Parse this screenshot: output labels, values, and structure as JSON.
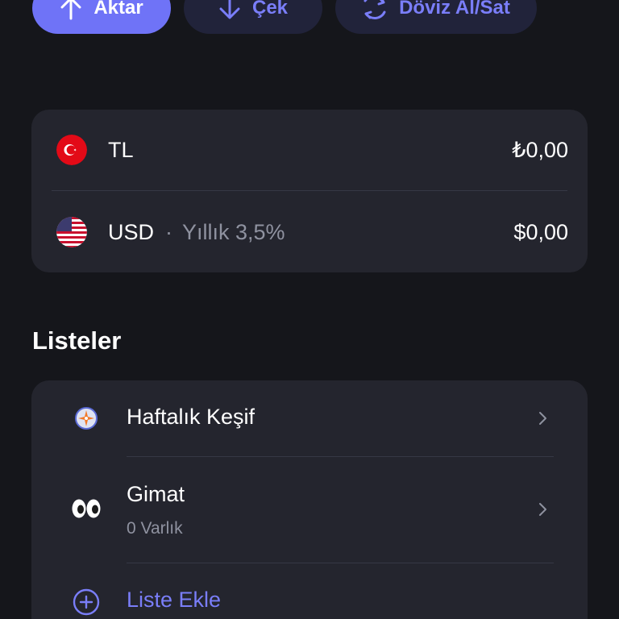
{
  "actions": {
    "transfer_label": "Aktar",
    "withdraw_label": "Çek",
    "fx_label": "Döviz Al/Sat",
    "accent": "#6f73f7"
  },
  "balances": [
    {
      "currency": "TL",
      "value": "₺0,00",
      "flag_icon": "turkey-flag-icon"
    },
    {
      "currency": "USD",
      "separator": "·",
      "rate": "Yıllık 3,5%",
      "value": "$0,00",
      "flag_icon": "usa-flag-icon"
    }
  ],
  "lists": {
    "title": "Listeler",
    "items": [
      {
        "label": "Haftalık Keşif",
        "icon": "compass-icon"
      },
      {
        "label": "Gimat",
        "sub": "0 Varlık",
        "icon": "eyes-emoji-icon"
      }
    ],
    "add_label": "Liste Ekle"
  }
}
